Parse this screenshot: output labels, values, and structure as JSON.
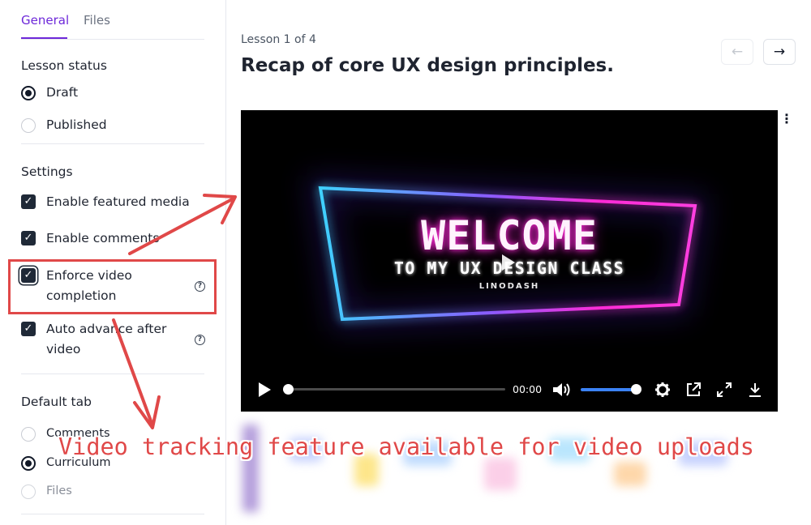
{
  "sidebar": {
    "tabs": [
      {
        "label": "General",
        "active": true
      },
      {
        "label": "Files",
        "active": false
      }
    ],
    "lesson_status": {
      "title": "Lesson status",
      "options": [
        {
          "label": "Draft",
          "selected": true
        },
        {
          "label": "Published",
          "selected": false
        }
      ]
    },
    "settings": {
      "title": "Settings",
      "items": [
        {
          "label": "Enable featured media",
          "checked": true
        },
        {
          "label": "Enable comments",
          "checked": true
        },
        {
          "label_line1": "Enforce video",
          "label_line2": "completion",
          "checked": true,
          "help": "?"
        },
        {
          "label_line1": "Auto advance after",
          "label_line2": "video",
          "checked": true,
          "help": "?"
        }
      ]
    },
    "default_tab": {
      "title": "Default tab",
      "options": [
        {
          "label": "Comments",
          "selected": false
        },
        {
          "label": "Curriculum",
          "selected": true
        },
        {
          "label": "Files",
          "selected": false
        }
      ]
    }
  },
  "main": {
    "breadcrumb": "Lesson 1 of 4",
    "title": "Recap of core UX design principles.",
    "nav": {
      "prev_icon": "arrow-left-icon",
      "next_icon": "arrow-right-icon",
      "prev_glyph": "←",
      "next_glyph": "→"
    },
    "more_menu_glyph": "⋮",
    "video": {
      "headline": "WELCOME",
      "subline": "TO MY UX DESIGN CLASS",
      "brand": "LINODASH",
      "time": "00:00",
      "progress": 0,
      "volume": 1
    }
  },
  "annotation": {
    "text": "Video tracking feature available for video uploads",
    "color": "#e04848"
  },
  "colors": {
    "accent": "#6d28d9",
    "highlight": "#e04848",
    "volume": "#3b82f6"
  }
}
